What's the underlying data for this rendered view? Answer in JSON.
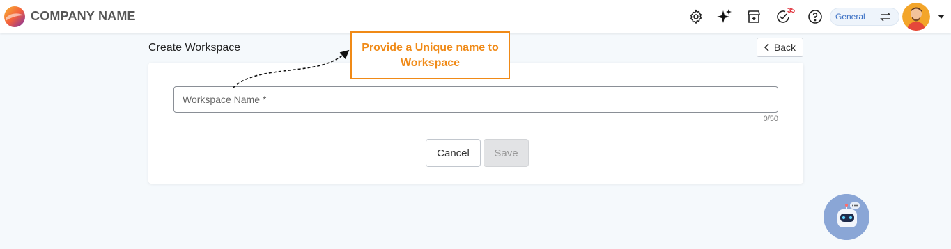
{
  "header": {
    "brand": "COMPANY NAME",
    "icons": [
      "settings-gear-icon",
      "ai-sparkle-icon",
      "store-icon",
      "tasks-check-icon",
      "help-icon"
    ],
    "tasks_badge": "35",
    "workspace_switcher": "General",
    "switch_icon": "swap-arrows-icon"
  },
  "page": {
    "title": "Create Workspace",
    "back_label": "Back"
  },
  "form": {
    "workspace_name_value": "",
    "workspace_name_placeholder": "Workspace Name *",
    "char_counter": "0/50",
    "cancel_label": "Cancel",
    "save_label": "Save",
    "save_disabled": true
  },
  "callout": {
    "text": "Provide a Unique name to Workspace"
  },
  "colors": {
    "accent_orange": "#f08a17",
    "badge_red": "#e0303a",
    "workspace_blue": "#3a6fc4",
    "page_bg": "#f5f9fc"
  }
}
